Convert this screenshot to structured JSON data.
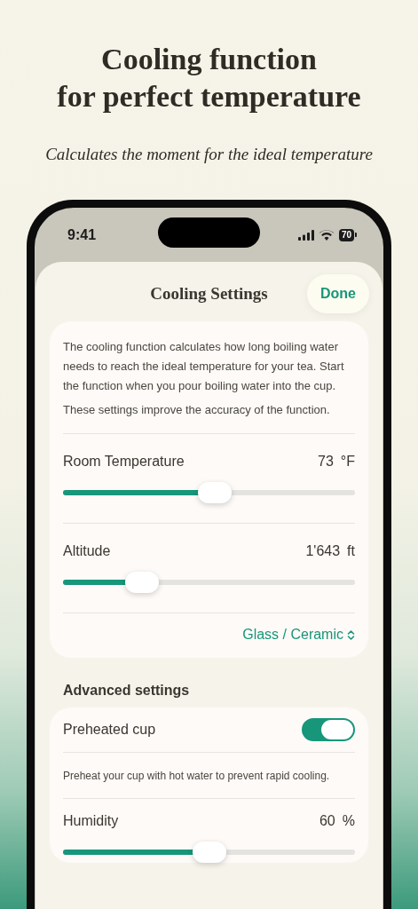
{
  "headline": [
    "Cooling function",
    "for perfect temperature"
  ],
  "subtitle": "Calculates the moment for the ideal temperature",
  "status_bar": {
    "time": "9:41",
    "battery": "70"
  },
  "sheet": {
    "title": "Cooling Settings",
    "done_button": "Done"
  },
  "intro": [
    "The cooling function calculates how long boiling water needs to reach the ideal temperature for your tea. Start the function when you pour boiling water into the cup.",
    "These settings improve the accuracy of the function."
  ],
  "settings": [
    {
      "kind": "slider",
      "label": "Room Temperature",
      "value": "73",
      "unit": "°F",
      "level": 0.52
    },
    {
      "kind": "slider",
      "label": "Altitude",
      "value": "1'643",
      "unit": "ft",
      "level": 0.27
    },
    {
      "kind": "picker",
      "value": "Glass / Ceramic"
    }
  ],
  "advanced": {
    "heading": "Advanced settings",
    "items": [
      {
        "kind": "toggle",
        "label": "Preheated cup",
        "on": true
      },
      {
        "kind": "note",
        "text": "Preheat your cup with hot water to prevent rapid cooling."
      },
      {
        "kind": "slider",
        "label": "Humidity",
        "value": "60",
        "unit": "%",
        "level": 0.5
      }
    ]
  }
}
